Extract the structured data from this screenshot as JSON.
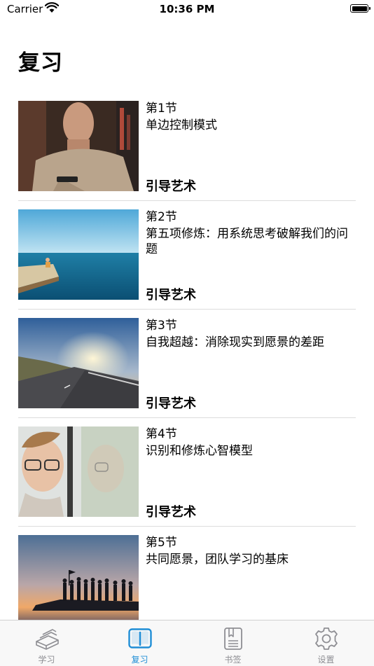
{
  "status_bar": {
    "carrier": "Carrier",
    "time": "10:36 PM"
  },
  "header": {
    "title": "复习"
  },
  "lessons": [
    {
      "lesson": "第1节",
      "chapter": "单边控制模式",
      "book": "引导艺术",
      "image": "man-portrait-photo"
    },
    {
      "lesson": "第2节",
      "chapter": "第五项修炼：用系统思考破解我们的问题",
      "book": "引导艺术",
      "image": "sea-pier-photo"
    },
    {
      "lesson": "第3节",
      "chapter": "自我超越：消除现实到愿景的差距",
      "book": "引导艺术",
      "image": "sunset-road-photo"
    },
    {
      "lesson": "第4节",
      "chapter": "识别和修炼心智模型",
      "book": "引导艺术",
      "image": "glasses-reflection-photo"
    },
    {
      "lesson": "第5节",
      "chapter": "共同愿景，团队学习的基床",
      "book": "",
      "image": "team-silhouette-photo"
    }
  ],
  "tab_bar": {
    "active_color": "#1f8ed6",
    "inactive_color": "#8e8e93",
    "tabs": [
      {
        "label": "学习",
        "icon": "book-stack-icon",
        "active": false
      },
      {
        "label": "复习",
        "icon": "open-book-icon",
        "active": true
      },
      {
        "label": "书签",
        "icon": "bookmark-icon",
        "active": false
      },
      {
        "label": "设置",
        "icon": "gear-icon",
        "active": false
      }
    ]
  }
}
